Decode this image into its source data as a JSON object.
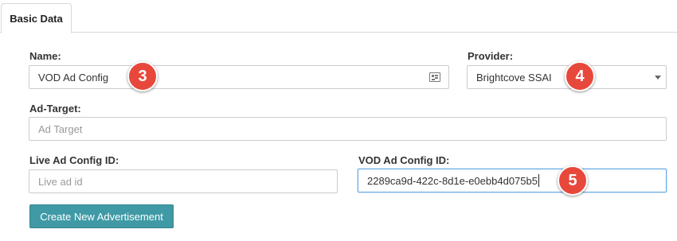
{
  "tabs": [
    {
      "label": "Basic Data",
      "active": true
    }
  ],
  "form": {
    "name": {
      "label": "Name:",
      "value": "VOD Ad Config"
    },
    "provider": {
      "label": "Provider:",
      "value": "Brightcove SSAI"
    },
    "ad_target": {
      "label": "Ad-Target:",
      "placeholder": "Ad Target"
    },
    "live_ad_config_id": {
      "label": "Live Ad Config ID:",
      "placeholder": "Live ad id"
    },
    "vod_ad_config_id": {
      "label": "VOD Ad Config ID:",
      "value": "2289ca9d-422c-8d1e-e0ebb4d075b5"
    }
  },
  "actions": {
    "create_label": "Create New Advertisement"
  },
  "callouts": [
    "3",
    "4",
    "5"
  ],
  "colors": {
    "accent_button": "#3f9aa6",
    "callout": "#e8483b",
    "focus_border": "#66a9e3"
  }
}
